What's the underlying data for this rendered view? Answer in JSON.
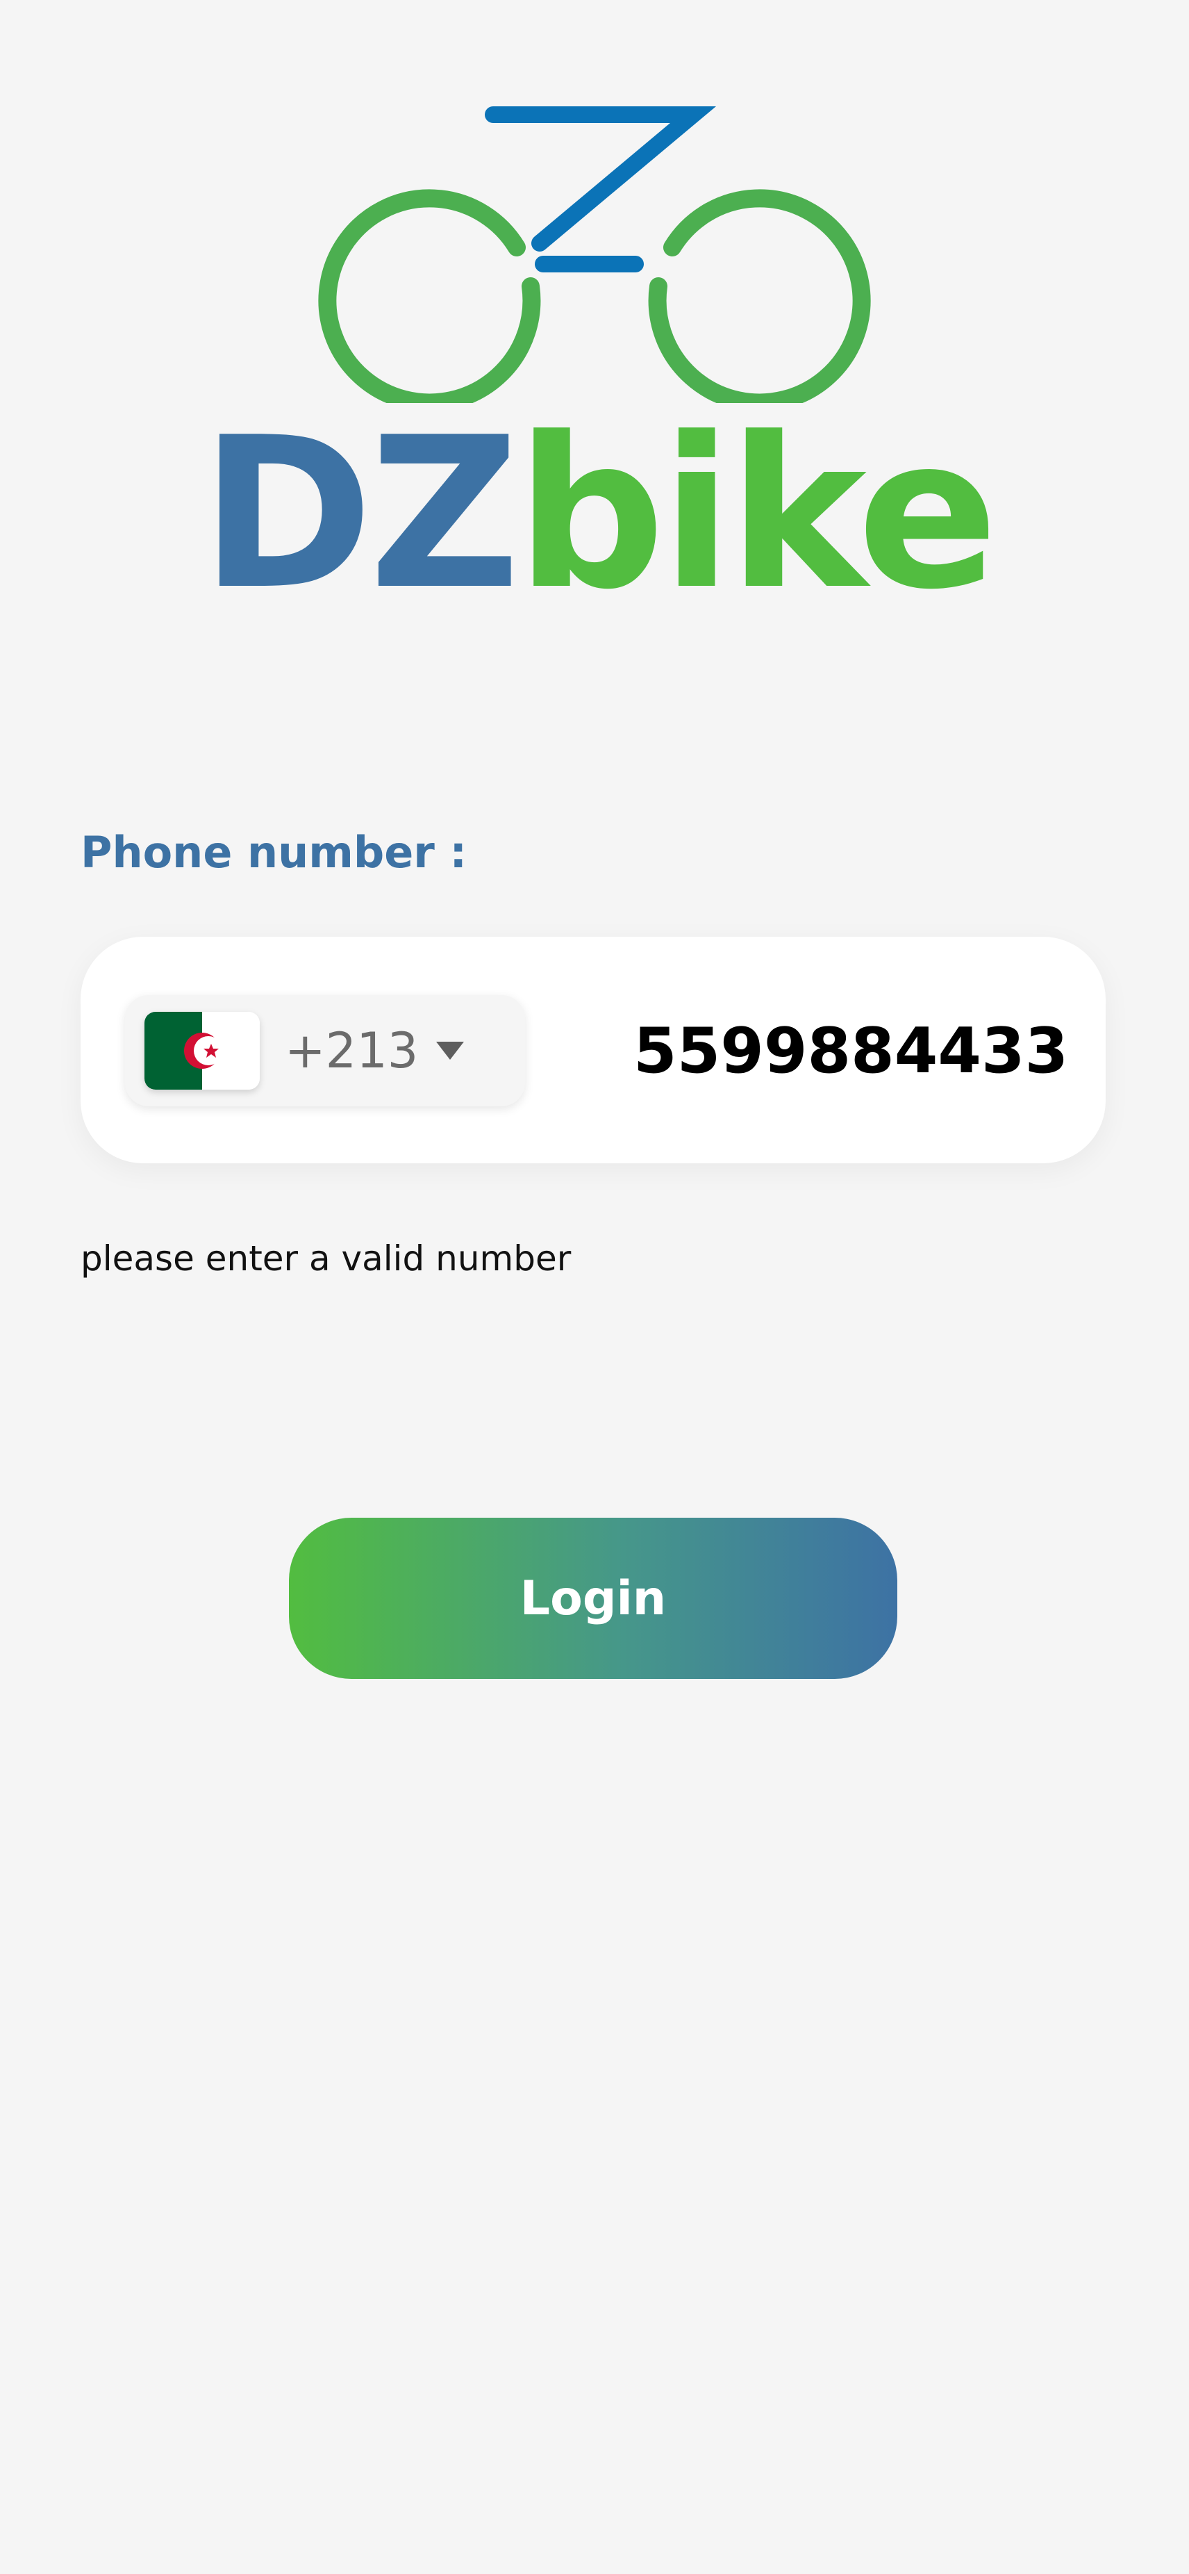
{
  "logo": {
    "text_part1": "DZ",
    "text_part2": "bike",
    "colors": {
      "blue": "#3d72a4",
      "green": "#52bd40",
      "frame_blue": "#0b73b7",
      "wheel_green": "#4caf50"
    },
    "icon": "bicycle-icon"
  },
  "phone": {
    "label": "Phone number :",
    "country": {
      "flag_icon": "algeria-flag-icon",
      "dial_code": "+213",
      "dropdown_icon": "caret-down-icon"
    },
    "number_value": "5599884433",
    "error": "please enter a valid number"
  },
  "login": {
    "label": "Login",
    "gradient": [
      "#52bd40",
      "#3d72a4"
    ]
  }
}
